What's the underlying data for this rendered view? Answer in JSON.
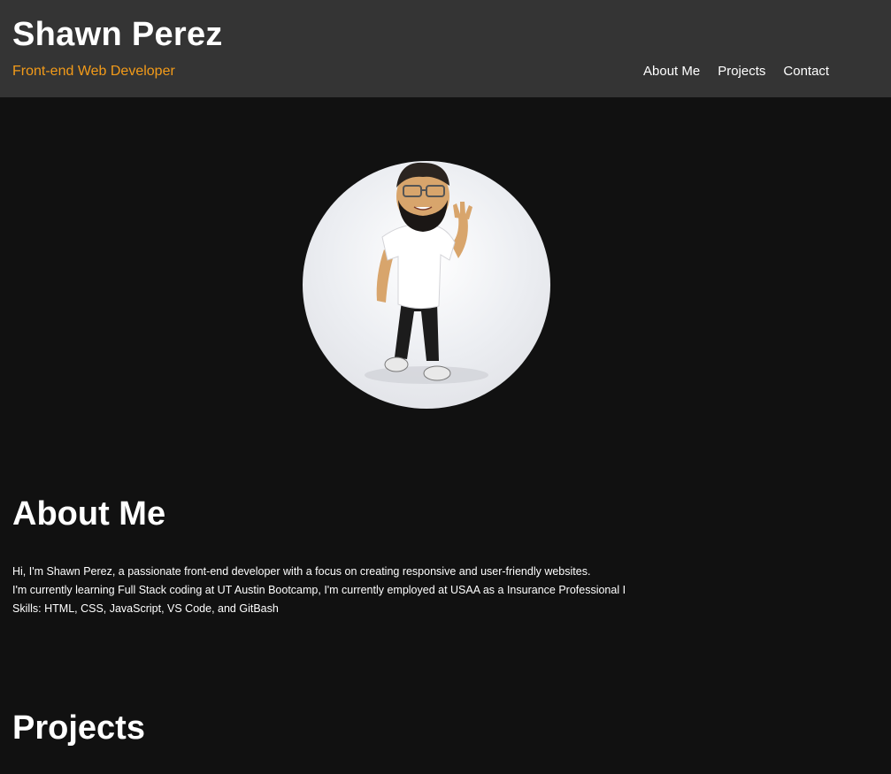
{
  "header": {
    "name": "Shawn Perez",
    "tagline": "Front-end Web Developer",
    "nav": [
      {
        "label": "About Me"
      },
      {
        "label": "Projects"
      },
      {
        "label": "Contact"
      }
    ]
  },
  "avatar": {
    "icon": "bitmoji-avatar-icon"
  },
  "about": {
    "title": "About Me",
    "lines": [
      "Hi, I'm Shawn Perez, a passionate front-end developer with a focus on creating responsive and user-friendly websites.",
      "I'm currently learning Full Stack coding at UT Austin Bootcamp, I'm currently employed at USAA as a Insurance Professional I",
      "Skills: HTML, CSS, JavaScript, VS Code, and GitBash"
    ]
  },
  "projects": {
    "title": "Projects"
  },
  "colors": {
    "background": "#111111",
    "header_bg": "#343434",
    "accent": "#f39b19",
    "text": "#ffffff"
  }
}
